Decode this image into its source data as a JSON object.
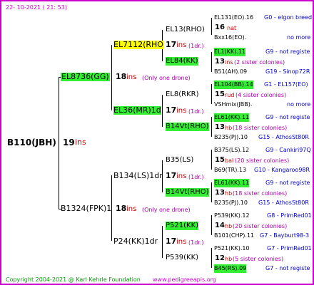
{
  "header": {
    "date": "22- 10-2021 ( 21: 53)"
  },
  "footer": {
    "copyright": "Copyright 2004-2021 @ Karl Kehrle Foundation",
    "url": "www.pedigreeapis.org"
  },
  "colors": {
    "border": "#cc00cc",
    "green": "#33ee33",
    "yellow": "#ffff00",
    "ins": "#cc0000",
    "blue": "#0000cc"
  },
  "root": {
    "name": "B110(JBH)",
    "num": "19",
    "ins": "ins"
  },
  "gen1": [
    {
      "name": "EL8736(GG)",
      "num": "18",
      "ins": "ins",
      "note": "(Only one drone)"
    },
    {
      "name": "B1324(FPK)1",
      "num": "18",
      "ins": "ins",
      "note": "(Only one drone)"
    }
  ],
  "gen2": [
    {
      "name": "EL7112(RHO",
      "num": "17",
      "ins": "ins",
      "note": "(1dr.)"
    },
    {
      "name": "EL36(MR)1d",
      "num": "17",
      "ins": "ins",
      "note": "(1dr.)"
    },
    {
      "name": "B134(LS)1dr",
      "num": "17",
      "ins": "ins",
      "note": "(1dr.)"
    },
    {
      "name": "P24(KK)1dr",
      "num": "17",
      "ins": "ins",
      "note": "(1dr.)"
    }
  ],
  "gen3": [
    {
      "name": "EL13(RHO)"
    },
    {
      "name": "EL84(KK)"
    },
    {
      "name": "EL8(RKR)"
    },
    {
      "name": "B14Vt(RHO)"
    },
    {
      "name": "B35(LS)"
    },
    {
      "name": "B14Vt(RHO)"
    },
    {
      "name": "P521(KK)"
    },
    {
      "name": "P539(KK)"
    }
  ],
  "gen4": [
    {
      "a": "EL131(EO).16",
      "b": "G0 - elgon breed",
      "c": "16",
      "d": "nat",
      "e": "Bxx16(EO).",
      "f": "no more"
    },
    {
      "a": "EL1(KK).11",
      "b": "G9 - not registe",
      "c": "13",
      "d": "ins",
      "dn": "(2 sister colonies)",
      "e": "B51(AH).09",
      "f": "G19 - Sinop72R"
    },
    {
      "a": "EL104(BB).14",
      "b": "G1 - EL157(EO)",
      "c": "15",
      "d": "rud",
      "dn": "(4 sister colonies)",
      "e": "VSHmix(JBB).",
      "f": "no more"
    },
    {
      "a": "EL61(KK).11",
      "b": "G9 - not registe",
      "c": "13",
      "d": "hb",
      "dn": "(18 sister colonies)",
      "e": "B235(PJ).10",
      "f": "G15 - AthosSt80R"
    },
    {
      "a": "B375(LS).12",
      "b": "G9 - Cankiri97Q",
      "c": "15",
      "d": "bal",
      "dn": "(20 sister colonies)",
      "e": "B69(TR).13",
      "f": "G10 - Kangaroo98R"
    },
    {
      "a": "EL61(KK).11",
      "b": "G9 - not registe",
      "c": "13",
      "d": "hb",
      "dn": "(18 sister colonies)",
      "e": "B235(PJ).10",
      "f": "G15 - AthosSt80R"
    },
    {
      "a": "P539(KK).12",
      "b": "G8 - PrimRed01",
      "c": "14",
      "d": "hb",
      "dn": "(20 sister colonies)",
      "e": "B101(CHP).11",
      "f": "G7 - Bayburt98-3"
    },
    {
      "a": "P521(KK).10",
      "b": "G7 - PrimRed01",
      "c": "12",
      "d": "hb",
      "dn": "(5 sister colonies)",
      "e": "B45(RS).09",
      "f": "G7 - not registe"
    }
  ]
}
